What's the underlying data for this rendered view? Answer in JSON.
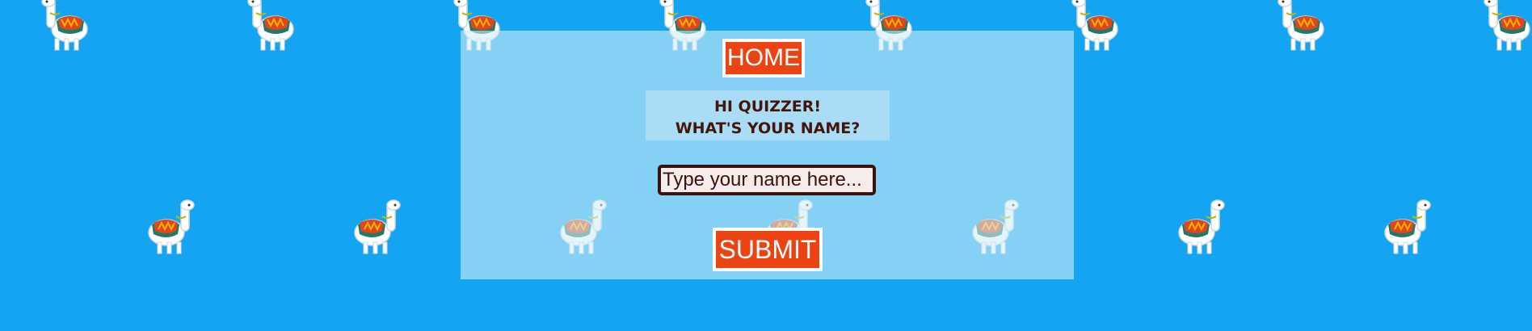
{
  "nav": {
    "home_label": "HOME"
  },
  "greeting": {
    "line1": "HI QUIZZER!",
    "line2": "WHAT'S YOUR NAME?"
  },
  "name_input": {
    "placeholder": "Type your name here...",
    "value": ""
  },
  "submit_label": "SUBMIT",
  "background": {
    "color": "#14a5f2",
    "pattern_icon": "llama-icon"
  },
  "colors": {
    "button": "#ec4313",
    "text": "#43160c",
    "input_border": "#3a140a"
  }
}
